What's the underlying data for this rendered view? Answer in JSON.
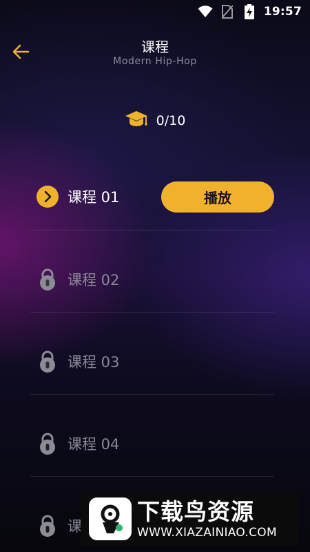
{
  "status_bar": {
    "time": "19:57",
    "icons": [
      "wifi-icon",
      "no-sim-icon",
      "battery-charging-icon"
    ]
  },
  "header": {
    "back_icon": "arrow-left-icon",
    "title": "课程",
    "subtitle": "Modern Hip-Hop"
  },
  "progress": {
    "icon": "graduation-cap-icon",
    "text": "0/10"
  },
  "lessons": [
    {
      "label": "课程 01",
      "state": "unlocked",
      "icon": "chevron-right-icon",
      "action_label": "播放"
    },
    {
      "label": "课程 02",
      "state": "locked",
      "icon": "lock-icon"
    },
    {
      "label": "课程 03",
      "state": "locked",
      "icon": "lock-icon"
    },
    {
      "label": "课程 04",
      "state": "locked",
      "icon": "lock-icon"
    },
    {
      "label": "课",
      "state": "locked",
      "icon": "lock-icon"
    }
  ],
  "watermark": {
    "title": "下载鸟资源",
    "url": "WWW.XIAZAINIAO.COM"
  },
  "colors": {
    "accent": "#f0b12c",
    "locked_text": "#8a8895",
    "subtitle_text": "#8c8aa0"
  }
}
